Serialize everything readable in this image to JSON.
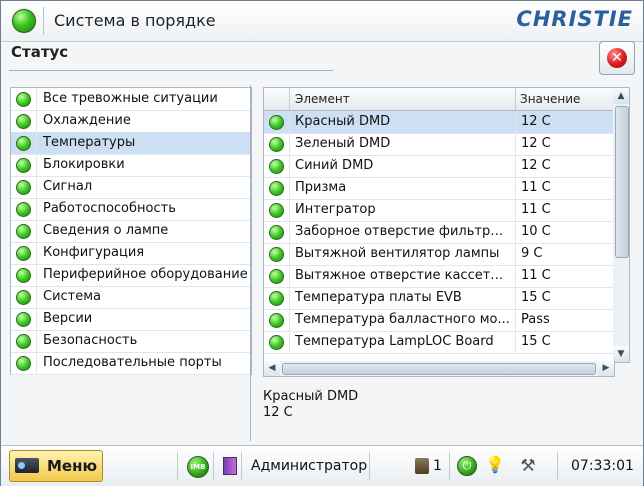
{
  "topbar": {
    "system_status": "Система в порядке",
    "logo_text": "CHRISTIE"
  },
  "header": {
    "title": "Статус"
  },
  "categories": [
    {
      "label": "Все тревожные ситуации"
    },
    {
      "label": "Охлаждение"
    },
    {
      "label": "Температуры",
      "selected": true
    },
    {
      "label": "Блокировки"
    },
    {
      "label": "Сигнал"
    },
    {
      "label": "Работоспособность"
    },
    {
      "label": "Сведения о лампе"
    },
    {
      "label": "Конфигурация"
    },
    {
      "label": "Периферийное оборудование"
    },
    {
      "label": "Система"
    },
    {
      "label": "Версии"
    },
    {
      "label": "Безопасность"
    },
    {
      "label": "Последовательные порты"
    }
  ],
  "table": {
    "columns": [
      "Элемент",
      "Значение"
    ],
    "rows": [
      {
        "name": "Красный DMD",
        "value": "12 C",
        "selected": true
      },
      {
        "name": "Зеленый DMD",
        "value": "12 C"
      },
      {
        "name": "Синий DMD",
        "value": "12 C"
      },
      {
        "name": "Призма",
        "value": "11 C"
      },
      {
        "name": "Интегратор",
        "value": "11 C"
      },
      {
        "name": "Заборное отверстие фильтро...",
        "value": "10 C"
      },
      {
        "name": "Вытяжной вентилятор лампы",
        "value": "9 C"
      },
      {
        "name": "Вытяжное отверстие кассеты ...",
        "value": "11 C"
      },
      {
        "name": "Температура платы EVB",
        "value": "15 C"
      },
      {
        "name": "Температура балластного мо...",
        "value": "Pass"
      },
      {
        "name": "Температура LampLOC Board",
        "value": "15 C"
      }
    ]
  },
  "detail": {
    "name": "Красный DMD",
    "value": "12 C"
  },
  "statusbar": {
    "menu_label": "Меню",
    "imb_label": "IMB",
    "user": "Администратор",
    "user_count": "1",
    "time": "07:33:01"
  },
  "colors": {
    "selection": "#cddff2",
    "status_ok": "#3fca23",
    "logo": "#2b5f9b",
    "menu_button": "#f2c84a"
  }
}
